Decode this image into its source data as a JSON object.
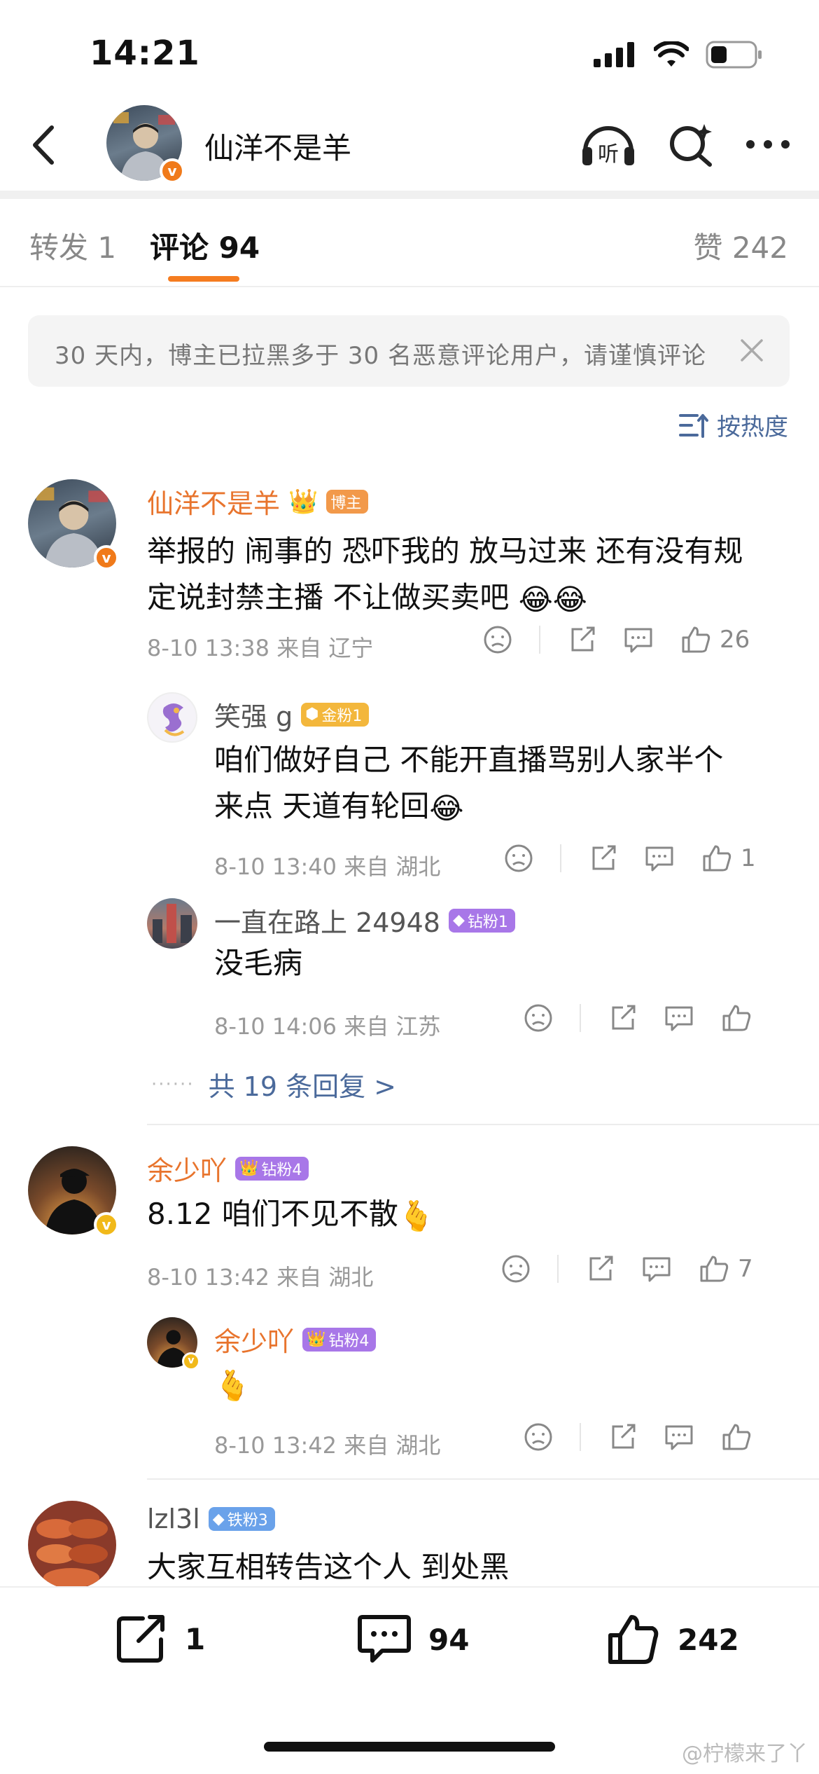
{
  "status": {
    "time": "14:21"
  },
  "nav": {
    "title": "仙洋不是羊"
  },
  "tabs": {
    "repost": "转发 1",
    "comments": "评论 94",
    "likes": "赞 242"
  },
  "notice": {
    "text": "30 天内，博主已拉黑多于 30 名恶意评论用户，请谨慎评论"
  },
  "sort": {
    "label": "按热度"
  },
  "comments": [
    {
      "name": "仙洋不是羊",
      "badge": "博主",
      "text_line1": "举报的 闹事的 恐吓我的 放马过来 还有没有规",
      "text_line2": "定说封禁主播 不让做买卖吧",
      "meta": "8-10 13:38  来自 辽宁",
      "likes": "26"
    },
    {
      "name": "笑强 g",
      "badge": "金粉1",
      "text_line1": "咱们做好自己  不能开直播骂别人家半个",
      "text_line2": "来点   天道有轮回",
      "meta": "8-10 13:40  来自 湖北",
      "likes": "1"
    },
    {
      "name": "一直在路上 24948",
      "badge": "钻粉1",
      "text_line1": "没毛病",
      "meta": "8-10 14:06  来自 江苏",
      "likes": ""
    },
    {
      "more": "共 19 条回复 >"
    },
    {
      "name": "余少吖",
      "badge": "钻粉4",
      "text_line1": "8.12 咱们不见不散",
      "meta": "8-10 13:42  来自 湖北",
      "likes": "7"
    },
    {
      "name": "余少吖",
      "badge": "钻粉4",
      "meta": "8-10 13:42  来自 湖北",
      "likes": ""
    },
    {
      "name": "lzl3l",
      "badge": "铁粉3",
      "text_line1": "大家互相转告这个人 到处黑"
    }
  ],
  "bottom": {
    "repost_count": "1",
    "comment_count": "94",
    "like_count": "242"
  },
  "watermark": "@柠檬来了丫"
}
